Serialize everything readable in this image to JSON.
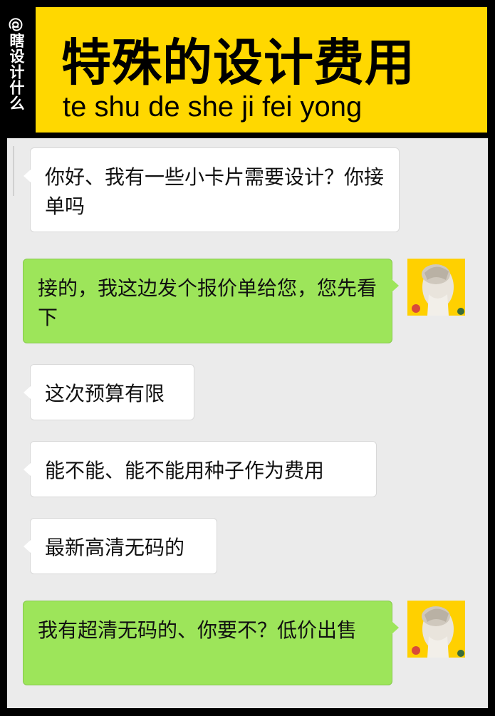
{
  "header": {
    "side_tag": "@瞎设计什么",
    "title": "特殊的设计费用",
    "pinyin": "te shu de she ji fei yong"
  },
  "colors": {
    "header_yellow": "#ffd800",
    "chat_background": "#ebebeb",
    "outgoing_bubble": "#9de55a",
    "incoming_bubble": "#ffffff"
  },
  "messages": [
    {
      "side": "incoming",
      "text": "你好、我有一些小卡片需要设计？你接单吗"
    },
    {
      "side": "outgoing",
      "text": "接的，我这边发个报价单给您，您先看下",
      "avatar": "sculpture-avatar"
    },
    {
      "side": "incoming",
      "text": "这次预算有限"
    },
    {
      "side": "incoming",
      "text": "能不能、能不能用种子作为费用"
    },
    {
      "side": "incoming",
      "text": "最新高清无码的"
    },
    {
      "side": "outgoing",
      "text": "我有超清无码的、你要不？低价出售",
      "avatar": "sculpture-avatar"
    }
  ]
}
